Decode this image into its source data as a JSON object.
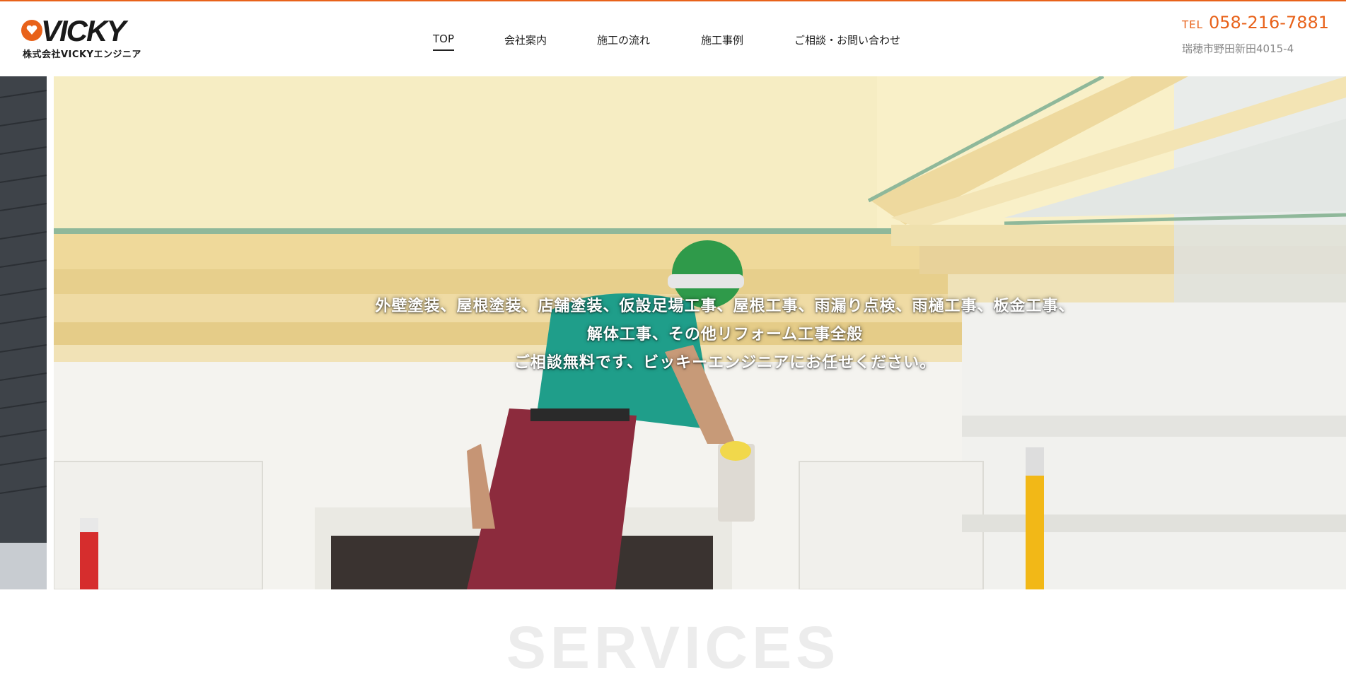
{
  "brand": {
    "logo_text": "VICKY",
    "company_name": "株式会社VICKYエンジニア",
    "accent_color": "#e8621a"
  },
  "nav": {
    "items": [
      {
        "label": "TOP",
        "active": true
      },
      {
        "label": "会社案内",
        "active": false
      },
      {
        "label": "施工の流れ",
        "active": false
      },
      {
        "label": "施工事例",
        "active": false
      },
      {
        "label": "ご相談・お問い合わせ",
        "active": false
      }
    ]
  },
  "contact": {
    "tel_label": "TEL",
    "tel_number": "058-216-7881",
    "address": "瑞穂市野田新田4015-4"
  },
  "hero": {
    "lines": [
      "外壁塗装、屋根塗装、店舗塗装、仮設足場工事、屋根工事、雨漏り点検、雨樋工事、板金工事、",
      "解体工事、その他リフォーム工事全般",
      "ご相談無料です、ビッキーエンジニアにお任せください。"
    ]
  },
  "services": {
    "title": "SERVICES"
  }
}
